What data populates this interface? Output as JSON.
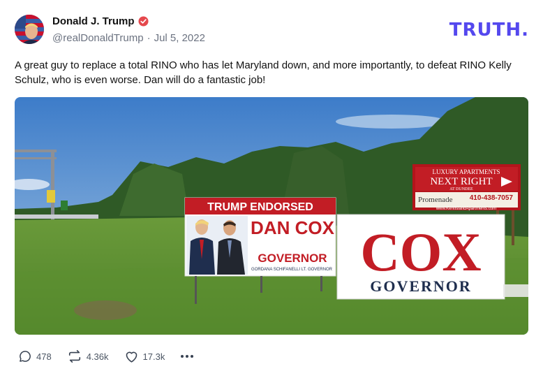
{
  "post": {
    "display_name": "Donald J. Trump",
    "handle": "@realDonaldTrump",
    "separator": "·",
    "date": "Jul 5, 2022",
    "text": "A great guy to replace a total RINO who has let Maryland down, and more importantly, to defeat RINO Kelly Schulz, who is even worse. Dan will do a fantastic job!"
  },
  "brand": {
    "name": "TRUTH",
    "dot": "."
  },
  "image": {
    "sign_left": {
      "banner": "TRUMP ENDORSED",
      "name": "DAN COX",
      "office": "GOVERNOR",
      "subline": "GORDANA SCHIFANELLI LT. GOVERNOR"
    },
    "sign_right": {
      "name": "COX",
      "office": "GOVERNOR"
    },
    "billboard": {
      "line1": "LUXURY APARTMENTS",
      "line2": "NEXT RIGHT",
      "line3": "AT DUNDEE",
      "brand": "Promenade",
      "phone": "410-438-7057",
      "url": "www.KentIslandApartments.com"
    }
  },
  "actions": {
    "replies": "478",
    "retruths": "4.36k",
    "likes": "17.3k"
  }
}
